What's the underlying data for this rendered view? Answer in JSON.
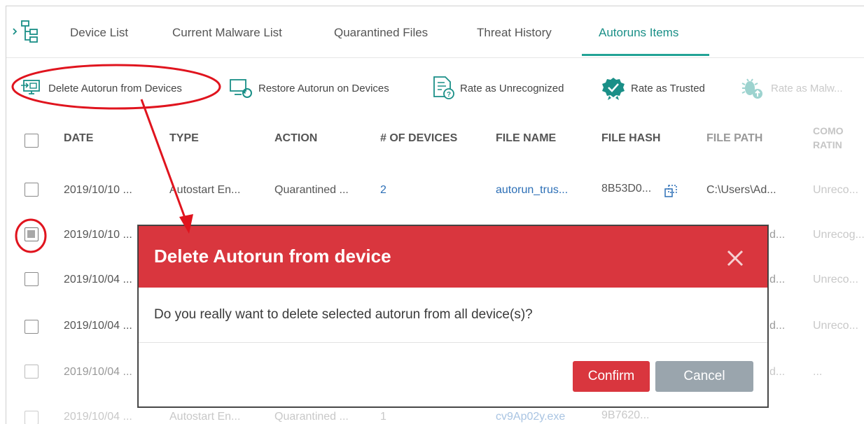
{
  "tabs": [
    {
      "label": "Device List"
    },
    {
      "label": "Current Malware List"
    },
    {
      "label": "Quarantined Files"
    },
    {
      "label": "Threat History"
    },
    {
      "label": "Autoruns Items"
    }
  ],
  "toolbar": {
    "delete_label": "Delete Autorun from Devices",
    "restore_label": "Restore Autorun on Devices",
    "unrecognized_label": "Rate as Unrecognized",
    "trusted_label": "Rate as Trusted",
    "malware_label": "Rate as Malw..."
  },
  "table": {
    "headers": {
      "date": "DATE",
      "type": "TYPE",
      "action": "ACTION",
      "devices": "# OF DEVICES",
      "file_name": "FILE NAME",
      "file_hash": "FILE HASH",
      "file_path": "FILE PATH",
      "comp_rating": "COMO RATIN"
    },
    "rows": [
      {
        "date": "2019/10/10 ...",
        "type": "Autostart En...",
        "action": "Quarantined ...",
        "devices": "2",
        "file_name": "autorun_trus...",
        "file_hash": "8B53D0...",
        "file_path": "C:\\Users\\Ad...",
        "rating": "Unreco..."
      },
      {
        "date": "2019/10/10 ...",
        "file_path": "d...",
        "rating": "Unrecog..."
      },
      {
        "date": "2019/10/04 ...",
        "file_path": "d...",
        "rating": "Unreco..."
      },
      {
        "date": "2019/10/04 ...",
        "file_path": "d...",
        "rating": "Unreco..."
      },
      {
        "date": "2019/10/04 ...",
        "file_path": "d...",
        "rating": "..."
      },
      {
        "date": "2019/10/04 ...",
        "type": "Autostart En...",
        "action": "Quarantined ...",
        "devices": "1",
        "file_name": "cv9Ap02y.exe",
        "file_hash": "9B7620..."
      }
    ]
  },
  "modal": {
    "title": "Delete Autorun from device",
    "message": "Do you really want to delete selected autorun from all device(s)?",
    "confirm_label": "Confirm",
    "cancel_label": "Cancel"
  },
  "colors": {
    "accent_teal": "#1a8f87",
    "danger_red": "#d9363e",
    "link_blue": "#2c6fb6",
    "cancel_gray": "#9aa5ad",
    "annotation_red": "#e0141e"
  }
}
